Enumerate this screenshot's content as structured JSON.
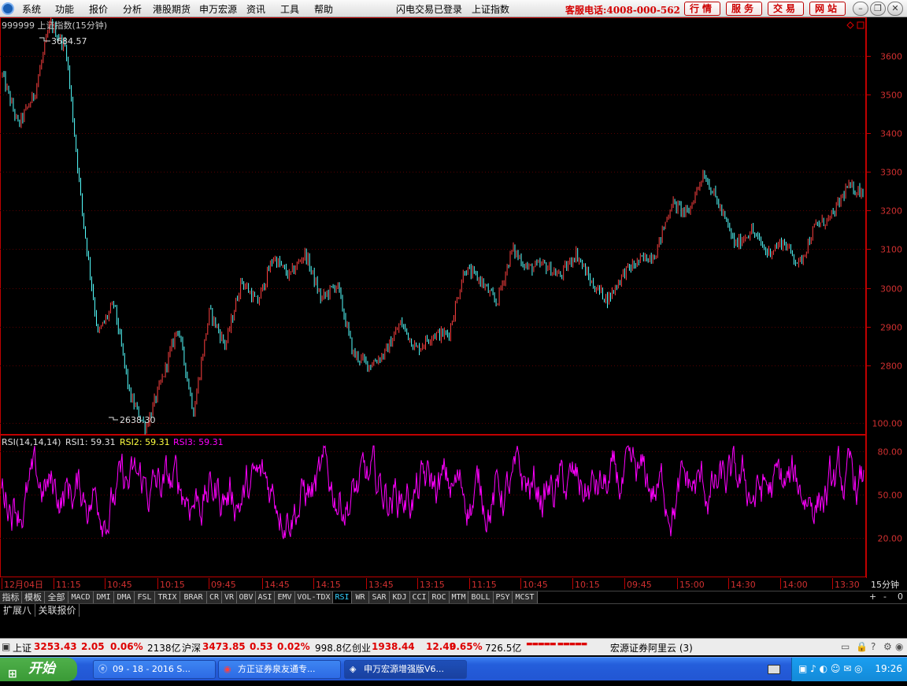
{
  "menu": {
    "items": [
      "系统",
      "功能",
      "报价",
      "分析",
      "港股期货",
      "申万宏源",
      "资讯",
      "工具",
      "帮助"
    ],
    "status": "闪电交易已登录",
    "current": "上证指数",
    "hotline": "客服电话:4008-000-562",
    "right_buttons": [
      "行情",
      "服务",
      "交易",
      "网站"
    ]
  },
  "chart": {
    "title": "999999 上证指数(15分钟)",
    "high_label": "3684.57",
    "low_label": "2638.30",
    "price_axis": [
      "3600",
      "3500",
      "3400",
      "3300",
      "3200",
      "3100",
      "3000",
      "2900",
      "2800"
    ],
    "rsi_header": {
      "name": "RSI(14,14,14)",
      "rsi1": "RSI1: 59.31",
      "rsi2": "RSI2: 59.31",
      "rsi3": "RSI3: 59.31"
    },
    "rsi_axis": [
      "100.00",
      "80.00",
      "50.00",
      "20.00"
    ],
    "time_axis": [
      "12月04日",
      "11:15",
      "10:45",
      "10:15",
      "09:45",
      "14:45",
      "14:15",
      "13:45",
      "13:15",
      "11:15",
      "10:45",
      "10:15",
      "09:45",
      "15:00",
      "14:30",
      "14:00",
      "13:30"
    ],
    "period": "15分钟",
    "colors": {
      "up": "#ff4040",
      "down": "#54ffff",
      "rsi": "#ff00ff",
      "axis": "#c00000",
      "grid": "#550000"
    }
  },
  "chart_data": {
    "type": "line",
    "title": "999999 上证指数(15分钟)",
    "price_range": [
      2620,
      3700
    ],
    "high": 3684.57,
    "low": 2638.3,
    "price_path": [
      3550,
      3420,
      3500,
      3684.57,
      3620,
      3200,
      2880,
      2960,
      2720,
      2638.3,
      2760,
      2900,
      2680,
      2940,
      2850,
      3020,
      2960,
      3080,
      3030,
      3090,
      2970,
      3010,
      2830,
      2800,
      2830,
      2910,
      2840,
      2880,
      2880,
      3050,
      3020,
      2960,
      3100,
      3050,
      3060,
      3030,
      3090,
      3010,
      2970,
      3040,
      3070,
      3090,
      3220,
      3190,
      3300,
      3210,
      3110,
      3150,
      3090,
      3120,
      3060,
      3160,
      3180,
      3260,
      3250
    ],
    "rsi_range": [
      0,
      100
    ],
    "rsi_last": 59.31
  },
  "ind_tabs": [
    "指标",
    "模板",
    "全部",
    "MACD",
    "DMI",
    "DMA",
    "FSL",
    "TRIX",
    "BRAR",
    "CR",
    "VR",
    "OBV",
    "ASI",
    "EMV",
    "VOL-TDX",
    "RSI",
    "WR",
    "SAR",
    "KDJ",
    "CCI",
    "ROC",
    "MTM",
    "BOLL",
    "PSY",
    "MCST"
  ],
  "ext_tabs": [
    "扩展八",
    "关联报价"
  ],
  "zoom_buttons": [
    "+",
    "-",
    "0"
  ],
  "ticker": {
    "sh_name": "上证",
    "sh_val": "3253.43",
    "sh_chg": "2.05",
    "sh_pct": "0.06%",
    "sh_amt": "2138亿",
    "hs_name": "沪深",
    "hs_val": "3473.85",
    "hs_chg": "0.53",
    "hs_pct": "0.02%",
    "hs_amt": "998.8亿",
    "cy_name": "创业",
    "cy_val": "1938.44",
    "cy_chg": "12.49",
    "cy_pct": "0.65%",
    "cy_amt": "726.5亿",
    "broker": "宏源证券阿里云 (3)"
  },
  "taskbar": {
    "start": "开始",
    "items": [
      "09 - 18 - 2016 S...",
      "方正证券泉友通专...",
      "申万宏源增强版V6..."
    ],
    "clock": "19:26"
  }
}
